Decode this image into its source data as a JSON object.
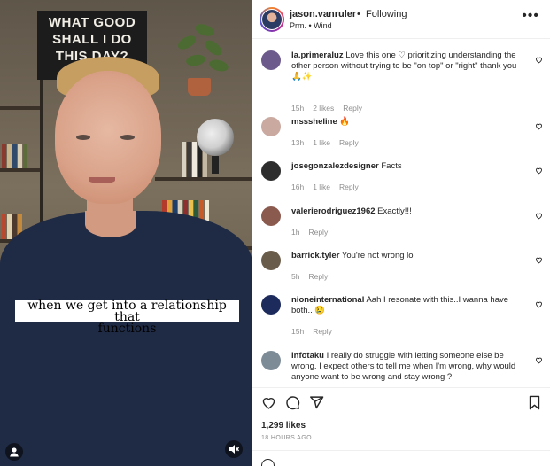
{
  "video": {
    "poster_lines": [
      "WHAT GOOD",
      "SHALL I DO",
      "THIS DAY?"
    ],
    "caption_lines": [
      "when we get into a relationship that",
      "functions"
    ]
  },
  "post": {
    "username": "jason.vanruler",
    "separator": "•",
    "follow_status": "Following",
    "audio": "Prm. • Wind",
    "more": "•••"
  },
  "comments": [
    {
      "user": "la.primeraluz",
      "text": "Love this one ♡ prioritizing understanding the other person without trying to be \"on top\" or \"right\" thank you 🙏✨",
      "time": "15h",
      "likes": "2 likes",
      "reply": "Reply",
      "avatar_color": "#6c5a8c"
    },
    {
      "user": "msssheline",
      "text": "🔥",
      "time": "13h",
      "likes": "1 like",
      "reply": "Reply",
      "avatar_color": "#c9a9a0"
    },
    {
      "user": "josegonzalezdesigner",
      "text": "Facts",
      "time": "16h",
      "likes": "1 like",
      "reply": "Reply",
      "avatar_color": "#2d2d2d"
    },
    {
      "user": "valerierodriguez1962",
      "text": "Exactly!!!",
      "time": "1h",
      "likes": "",
      "reply": "Reply",
      "avatar_color": "#8b5a4e"
    },
    {
      "user": "barrick.tyler",
      "text": "You're not wrong lol",
      "time": "5h",
      "likes": "",
      "reply": "Reply",
      "avatar_color": "#6a5c4a"
    },
    {
      "user": "nioneinternational",
      "text": "Aah I resonate with this..I wanna have both.. 😢",
      "time": "15h",
      "likes": "",
      "reply": "Reply",
      "avatar_color": "#1d2b5c"
    },
    {
      "user": "infotaku",
      "text": "I really do struggle with letting someone else be wrong. I expect others to tell me when I'm wrong, why would anyone want to be wrong and stay wrong ?",
      "time": "",
      "likes": "",
      "reply": "",
      "avatar_color": "#7d8b96"
    }
  ],
  "footer": {
    "likes": "1,299 likes",
    "date": "18 HOURS AGO"
  },
  "icons": {
    "like": "heart-icon",
    "comment": "comment-icon",
    "share": "send-icon",
    "save": "bookmark-icon",
    "mute": "muted-speaker-icon",
    "user": "user-tag-icon"
  }
}
